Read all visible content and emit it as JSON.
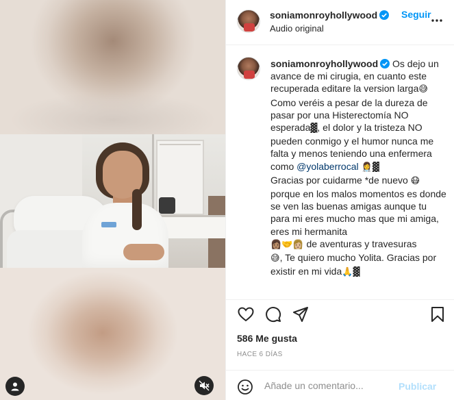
{
  "header": {
    "username": "soniamonroyhollywood",
    "follow_label": "Seguir",
    "audio_label": "Audio original"
  },
  "caption": {
    "username": "soniamonroyhollywood",
    "text_1": "Os dejo un avance de mi cirugia, en cuanto este recuperada editare la version larga",
    "emoji_1": "😅",
    "text_2": " Como veréis a pesar de la dureza de pasar por una Histerectomía NO esperada",
    "emoji_2": "▓",
    "text_3": ", el dolor y la tristeza NO pueden conmigo y el humor nunca me falta y menos teniendo una enfermera como ",
    "mention": "@yolaberrocal",
    "emoji_3": " 👩‍⚕️▓",
    "text_4": "Gracias por cuidarme *de nuevo ",
    "emoji_4": "😷",
    "text_5": " porque en los malos momentos es donde se ven las buenas amigas aunque tu para mi eres mucho mas que mi amiga, eres mi hermanita",
    "emoji_5": "👩🏽🤝👩🏼",
    "text_6": " de aventuras y travesuras",
    "emoji_6": "😅",
    "text_7": ", Te quiero mucho Yolita. Gracias por existir en mi vida",
    "emoji_7": "🙏▓"
  },
  "stats": {
    "likes": "586 Me gusta",
    "time": "HACE 6 DÍAS"
  },
  "comment": {
    "placeholder": "Añade un comentario...",
    "publish_label": "Publicar"
  },
  "colors": {
    "accent": "#0095f6",
    "publish_disabled": "#b2dffc",
    "mention": "#00376b",
    "muted": "#8e8e8e"
  },
  "icons": [
    "user-icon",
    "mute-icon",
    "verified-icon",
    "more-icon",
    "heart-icon",
    "comment-icon",
    "share-icon",
    "bookmark-icon",
    "emoji-icon"
  ]
}
